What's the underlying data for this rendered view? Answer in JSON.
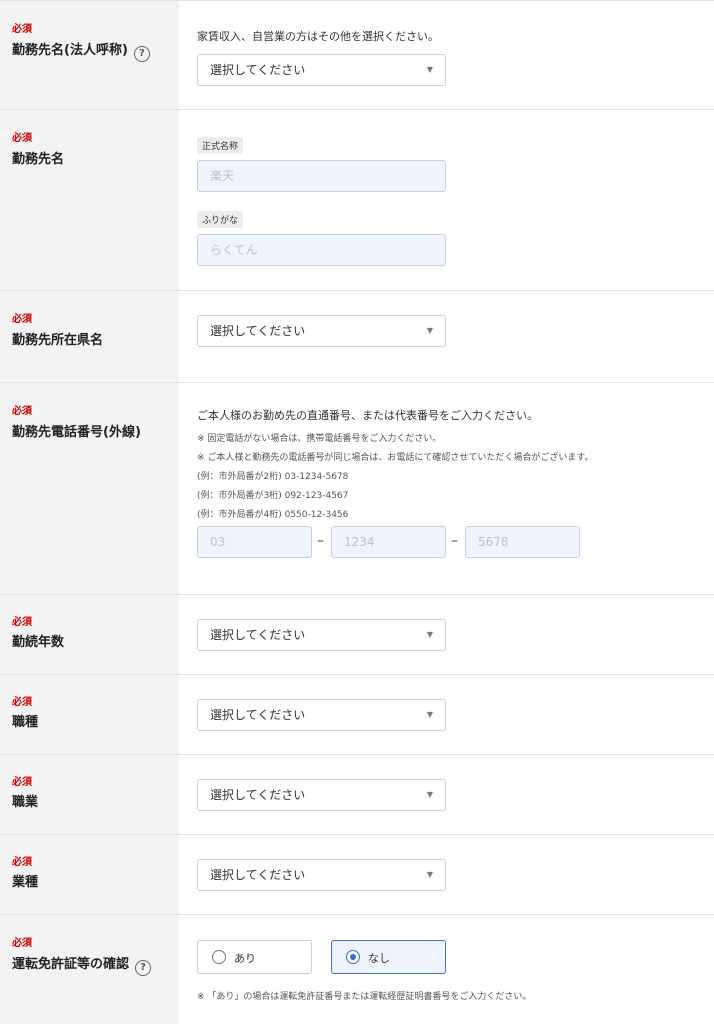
{
  "required_label": "必須",
  "fields": {
    "company_type": {
      "title": "勤務先名(法人呼称)",
      "note": "家賃収入、自営業の方はその他を選択ください。",
      "select_value": "選択してください"
    },
    "company_name": {
      "title": "勤務先名",
      "official_tag": "正式名称",
      "official_placeholder": "楽天",
      "kana_tag": "ふりがな",
      "kana_placeholder": "らくてん"
    },
    "prefecture": {
      "title": "勤務先所在県名",
      "select_value": "選択してください"
    },
    "phone": {
      "title": "勤務先電話番号(外線)",
      "note": "ご本人様のお勤め先の直通番号、または代表番号をご入力ください。",
      "notes_small": [
        "※ 固定電話がない場合は、携帯電話番号をご入力ください。",
        "※ ご本人様と勤務先の電話番号が同じ場合は、お電話にて確認させていただく場合がございます。",
        "(例：市外局番が2桁)  03-1234-5678",
        "(例：市外局番が3桁)  092-123-4567",
        "(例：市外局番が4桁)  0550-12-3456"
      ],
      "placeholders": [
        "03",
        "1234",
        "5678"
      ],
      "separator": "–"
    },
    "years": {
      "title": "勤続年数",
      "select_value": "選択してください"
    },
    "job_type": {
      "title": "職種",
      "select_value": "選択してください"
    },
    "occupation": {
      "title": "職業",
      "select_value": "選択してください"
    },
    "industry": {
      "title": "業種",
      "select_value": "選択してください"
    },
    "license": {
      "title": "運転免許証等の確認",
      "options": [
        "あり",
        "なし"
      ],
      "selected": "なし",
      "note": "※ 「あり」の場合は運転免許証番号または運転経歴証明書番号をご入力ください。"
    }
  },
  "icons": {
    "help": "question-circle-icon",
    "dropdown": "triangle-down-icon"
  },
  "colors": {
    "required": "#d10000",
    "accent": "#3a6fd8",
    "label_bg": "#f3f3f3"
  }
}
